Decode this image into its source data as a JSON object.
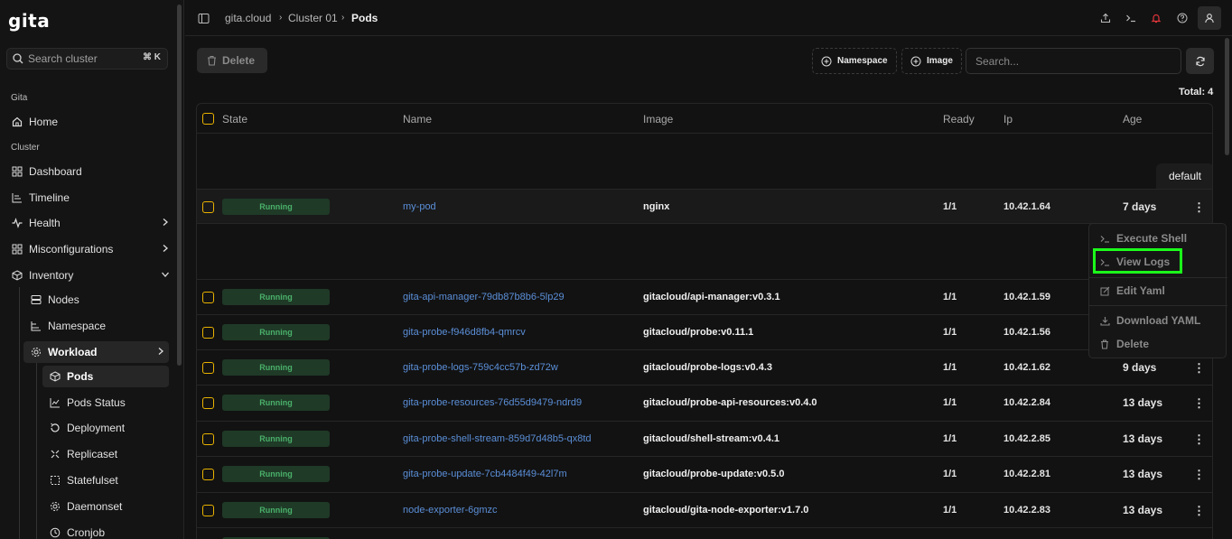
{
  "app": {
    "logo": "gita"
  },
  "sidebar": {
    "search": {
      "placeholder": "Search cluster",
      "shortcut": "⌘ K"
    },
    "sections": {
      "gita": "Gita",
      "cluster": "Cluster"
    },
    "items": {
      "home": "Home",
      "dashboard": "Dashboard",
      "timeline": "Timeline",
      "health": "Health",
      "misconfigurations": "Misconfigurations",
      "inventory": "Inventory",
      "nodes": "Nodes",
      "namespace": "Namespace",
      "workload": "Workload",
      "pods": "Pods",
      "pods_status": "Pods Status",
      "deployment": "Deployment",
      "replicaset": "Replicaset",
      "statefulset": "Statefulset",
      "daemonset": "Daemonset",
      "cronjob": "Cronjob"
    }
  },
  "breadcrumb": [
    "gita.cloud",
    "Cluster 01",
    "Pods"
  ],
  "toolbar": {
    "delete_label": "Delete",
    "namespace_filter": "Namespace",
    "image_filter": "Image",
    "search_placeholder": "Search..."
  },
  "total": "Total: 4",
  "table": {
    "headers": [
      "State",
      "Name",
      "Image",
      "Ready",
      "Ip",
      "Age"
    ],
    "namespace_tab": "default",
    "rows": [
      {
        "state": "Running",
        "name": "my-pod",
        "image": "nginx",
        "ready": "1/1",
        "ip": "10.42.1.64",
        "age": "7 days"
      },
      {
        "state": "Running",
        "name": "gita-api-manager-79db87b8b6-5lp29",
        "image": "gitacloud/api-manager:v0.3.1",
        "ready": "1/1",
        "ip": "10.42.1.59",
        "age": ""
      },
      {
        "state": "Running",
        "name": "gita-probe-f946d8fb4-qmrcv",
        "image": "gitacloud/probe:v0.11.1",
        "ready": "1/1",
        "ip": "10.42.1.56",
        "age": ""
      },
      {
        "state": "Running",
        "name": "gita-probe-logs-759c4cc57b-zd72w",
        "image": "gitacloud/probe-logs:v0.4.3",
        "ready": "1/1",
        "ip": "10.42.1.62",
        "age": "9 days"
      },
      {
        "state": "Running",
        "name": "gita-probe-resources-76d55d9479-ndrd9",
        "image": "gitacloud/probe-api-resources:v0.4.0",
        "ready": "1/1",
        "ip": "10.42.2.84",
        "age": "13 days"
      },
      {
        "state": "Running",
        "name": "gita-probe-shell-stream-859d7d48b5-qx8td",
        "image": "gitacloud/shell-stream:v0.4.1",
        "ready": "1/1",
        "ip": "10.42.2.85",
        "age": "13 days"
      },
      {
        "state": "Running",
        "name": "gita-probe-update-7cb4484f49-42l7m",
        "image": "gitacloud/probe-update:v0.5.0",
        "ready": "1/1",
        "ip": "10.42.2.81",
        "age": "13 days"
      },
      {
        "state": "Running",
        "name": "node-exporter-6gmzc",
        "image": "gitacloud/gita-node-exporter:v1.7.0",
        "ready": "1/1",
        "ip": "10.42.2.83",
        "age": "13 days"
      }
    ]
  },
  "context_menu": {
    "execute_shell": "Execute Shell",
    "view_logs": "View Logs",
    "edit_yaml": "Edit Yaml",
    "download_yaml": "Download YAML",
    "delete": "Delete"
  },
  "colors": {
    "running_bg": "#1f3a27",
    "running_text": "#4ab06a",
    "link": "#5b8fd8",
    "checkbox": "#e8b200",
    "focus": "#1bff1b"
  }
}
